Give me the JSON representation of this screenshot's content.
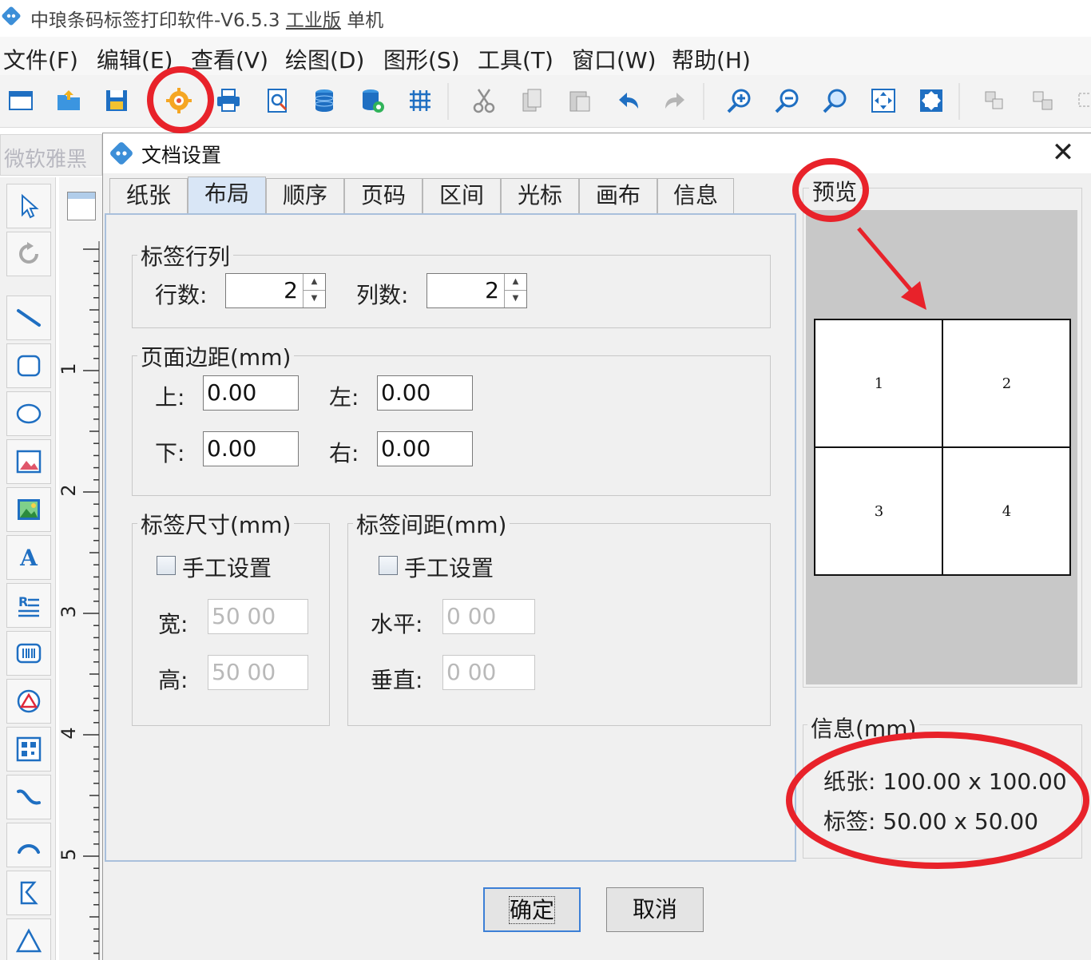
{
  "app": {
    "title_main": "中琅条码标签打印软件-V6.5.3",
    "title_edition": "工业版",
    "title_mode": "单机"
  },
  "menu": [
    {
      "label": "文件(F)"
    },
    {
      "label": "编辑(E)"
    },
    {
      "label": "查看(V)"
    },
    {
      "label": "绘图(D)"
    },
    {
      "label": "图形(S)"
    },
    {
      "label": "工具(T)"
    },
    {
      "label": "窗口(W)"
    },
    {
      "label": "帮助(H)"
    }
  ],
  "toolbar": {
    "icons": [
      "new-document-icon",
      "open-folder-icon",
      "save-icon",
      "document-settings-icon",
      "print-icon",
      "print-preview-icon",
      "database-icon",
      "database-settings-icon",
      "grid-icon",
      "cut-icon",
      "copy-icon",
      "paste-icon",
      "undo-icon",
      "redo-icon",
      "zoom-in-icon",
      "zoom-out-icon",
      "zoom-fit-icon",
      "fit-page-icon",
      "actual-size-icon",
      "group-icon",
      "ungroup-icon",
      "align-icon"
    ],
    "highlighted": "document-settings-icon"
  },
  "font_selector": {
    "value": "微软雅黑"
  },
  "left_tools": [
    "select-tool-icon",
    "rotate-tool-icon",
    "line-tool-icon",
    "rounded-rect-tool-icon",
    "ellipse-tool-icon",
    "image-frame-tool-icon",
    "picture-tool-icon",
    "text-tool-icon",
    "rich-text-tool-icon",
    "barcode-tool-icon",
    "shape-tool-icon",
    "qrcode-tool-icon",
    "curve-tool-icon",
    "arc-tool-icon",
    "polygon-tool-icon",
    "triangle-tool-icon"
  ],
  "ruler": {
    "labels": [
      "1",
      "2",
      "3",
      "4",
      "5"
    ]
  },
  "dialog": {
    "title": "文档设置",
    "close_glyph": "✕",
    "tabs": [
      {
        "label": "纸张",
        "active": false
      },
      {
        "label": "布局",
        "active": true
      },
      {
        "label": "顺序",
        "active": false
      },
      {
        "label": "页码",
        "active": false
      },
      {
        "label": "区间",
        "active": false
      },
      {
        "label": "光标",
        "active": false
      },
      {
        "label": "画布",
        "active": false
      },
      {
        "label": "信息",
        "active": false
      }
    ],
    "rows_cols": {
      "group_title": "标签行列",
      "rows_label": "行数:",
      "rows_value": "2",
      "cols_label": "列数:",
      "cols_value": "2"
    },
    "margins": {
      "group_title": "页面边距(mm)",
      "top_label": "上:",
      "top_value": "0.00",
      "left_label": "左:",
      "left_value": "0.00",
      "bottom_label": "下:",
      "bottom_value": "0.00",
      "right_label": "右:",
      "right_value": "0.00"
    },
    "label_size": {
      "group_title": "标签尺寸(mm)",
      "manual_label": "手工设置",
      "manual_checked": false,
      "width_label": "宽:",
      "width_value": "50 00",
      "height_label": "高:",
      "height_value": "50 00"
    },
    "label_spacing": {
      "group_title": "标签间距(mm)",
      "manual_label": "手工设置",
      "manual_checked": false,
      "horizontal_label": "水平:",
      "horizontal_value": "0 00",
      "vertical_label": "垂直:",
      "vertical_value": "0 00"
    },
    "preview": {
      "title": "预览",
      "cells": [
        "1",
        "2",
        "3",
        "4"
      ]
    },
    "info": {
      "title": "信息(mm)",
      "paper_label": "纸张:",
      "paper_value": "100.00 x 100.00",
      "label_label": "标签:",
      "label_value": "50.00 x 50.00"
    },
    "buttons": {
      "ok": "确定",
      "cancel": "取消"
    }
  },
  "colors": {
    "annotation_red": "#e8222a",
    "active_tab": "#d9e6f6",
    "dialog_bg": "#f0f0f0",
    "preview_bg": "#c8c8c8"
  }
}
